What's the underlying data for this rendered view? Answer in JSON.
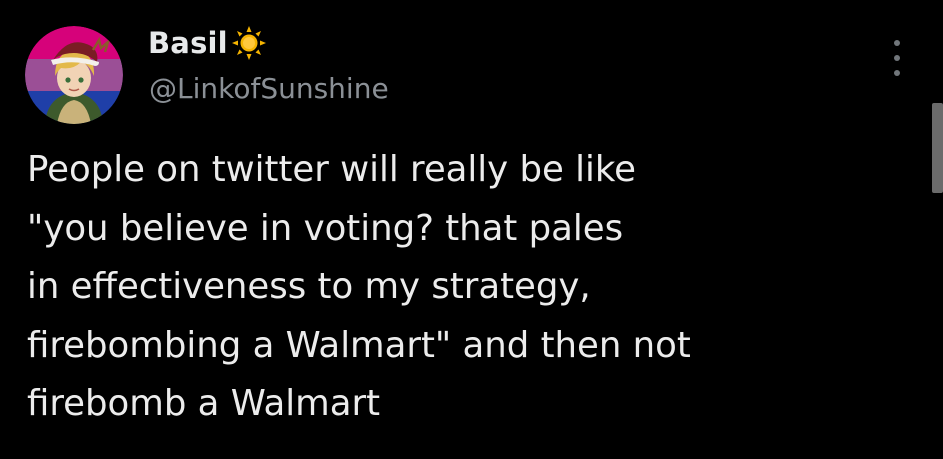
{
  "author": {
    "display_name": "Basil",
    "name_emoji": "sun-icon",
    "handle": "@LinkofSunshine",
    "avatar": "avatar-icon"
  },
  "tweet": {
    "lines": [
      "People on twitter will really be like",
      "\"you believe in voting? that pales",
      "in effectiveness to my strategy,",
      "firebombing a Walmart\" and then not",
      "firebomb a Walmart"
    ]
  },
  "menu": {
    "icon": "more-options-icon"
  },
  "colors": {
    "background": "#000000",
    "text": "#e7e9ea",
    "handle": "#8b9096",
    "sun": "#f5b400"
  }
}
